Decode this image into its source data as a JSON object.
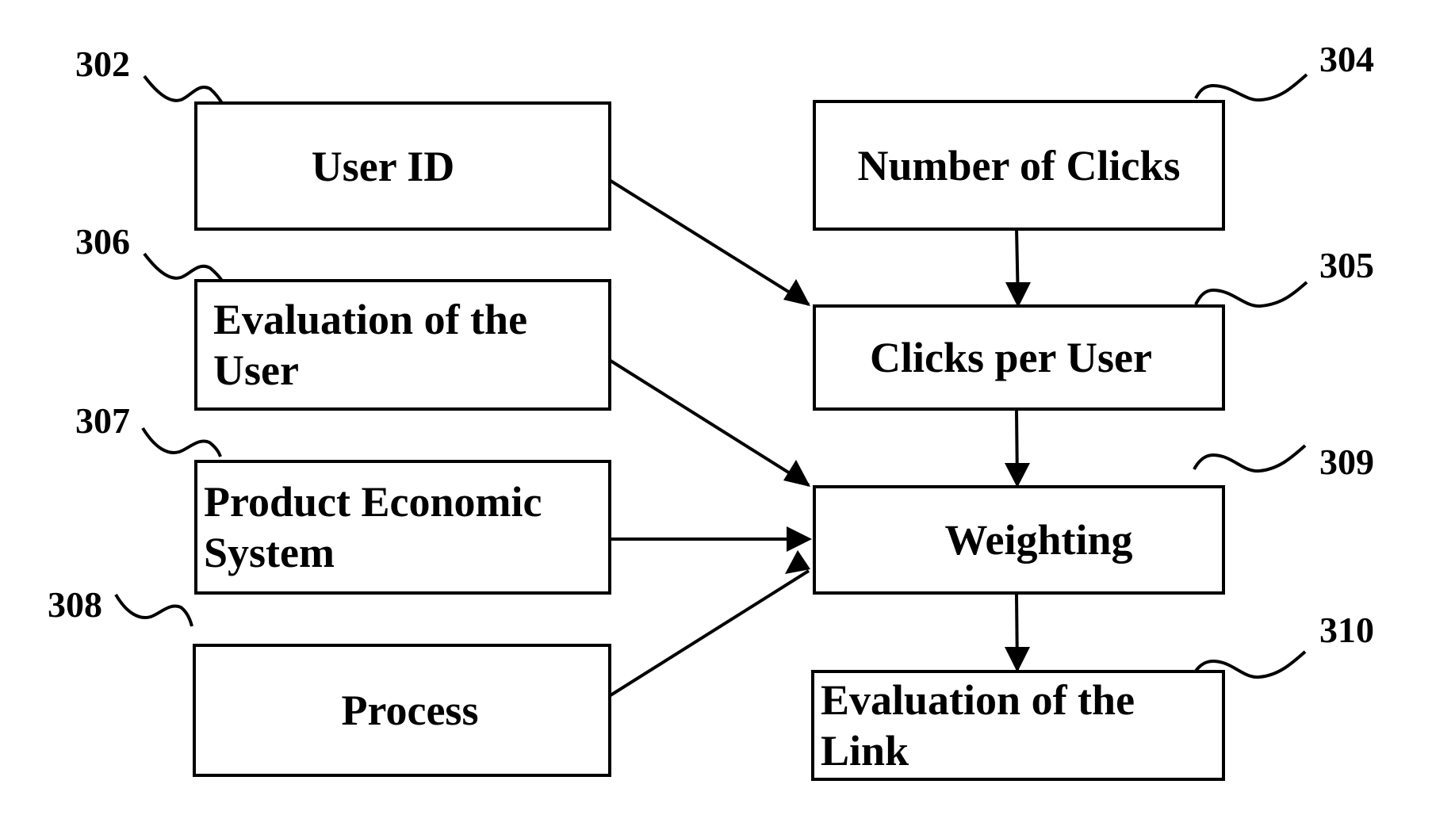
{
  "diagram": {
    "type": "flowchart",
    "nodes": [
      {
        "id": "302",
        "ref": "302",
        "label": "User ID"
      },
      {
        "id": "304",
        "ref": "304",
        "label": "Number of Clicks"
      },
      {
        "id": "305",
        "ref": "305",
        "label": "Clicks per User"
      },
      {
        "id": "306",
        "ref": "306",
        "label_line1": "Evaluation of the",
        "label_line2": "User"
      },
      {
        "id": "307",
        "ref": "307",
        "label_line1": "Product Economic",
        "label_line2": "System"
      },
      {
        "id": "308",
        "ref": "308",
        "label": "Process"
      },
      {
        "id": "309",
        "ref": "309",
        "label": "Weighting"
      },
      {
        "id": "310",
        "ref": "310",
        "label_line1": "Evaluation of the",
        "label_line2": "Link"
      }
    ],
    "edges": [
      {
        "from": "302",
        "to": "305"
      },
      {
        "from": "304",
        "to": "305"
      },
      {
        "from": "305",
        "to": "309"
      },
      {
        "from": "306",
        "to": "309"
      },
      {
        "from": "307",
        "to": "309"
      },
      {
        "from": "308",
        "to": "309"
      },
      {
        "from": "309",
        "to": "310"
      }
    ]
  }
}
